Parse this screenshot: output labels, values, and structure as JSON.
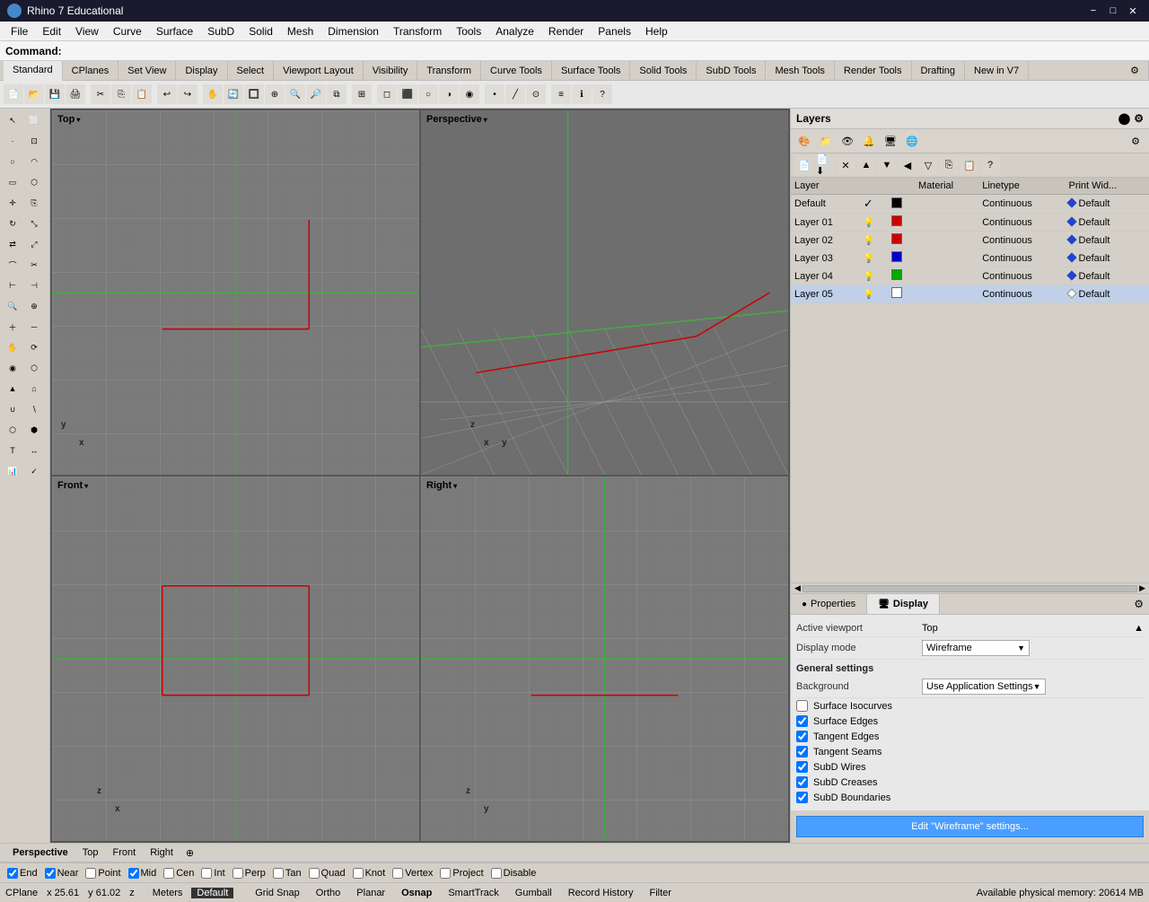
{
  "titlebar": {
    "icon": "rhino-icon",
    "title": "Rhino 7 Educational",
    "minimize": "−",
    "maximize": "□",
    "close": "✕"
  },
  "menubar": {
    "items": [
      "File",
      "Edit",
      "View",
      "Curve",
      "Surface",
      "SubD",
      "Solid",
      "Mesh",
      "Dimension",
      "Transform",
      "Tools",
      "Analyze",
      "Render",
      "Panels",
      "Help"
    ]
  },
  "commandbar": {
    "label": "Command:",
    "placeholder": ""
  },
  "toolbar_tabs": {
    "tabs": [
      "Standard",
      "CPlanes",
      "Set View",
      "Display",
      "Select",
      "Viewport Layout",
      "Visibility",
      "Transform",
      "Curve Tools",
      "Surface Tools",
      "Solid Tools",
      "SubD Tools",
      "Mesh Tools",
      "Render Tools",
      "Drafting",
      "New in V7"
    ]
  },
  "viewports": {
    "top": {
      "label": "Top",
      "arrow": "▾"
    },
    "perspective": {
      "label": "Perspective",
      "arrow": "▾"
    },
    "front": {
      "label": "Front",
      "arrow": "▾"
    },
    "right": {
      "label": "Right",
      "arrow": "▾"
    }
  },
  "layers_panel": {
    "title": "Layers",
    "columns": [
      "Layer",
      "",
      "",
      "Material",
      "Linetype",
      "Print Width"
    ],
    "rows": [
      {
        "name": "Default",
        "checked": true,
        "color": "black",
        "material": "",
        "linetype": "Continuous",
        "printwidth": "Default",
        "diamond": "filled"
      },
      {
        "name": "Layer 01",
        "checked": false,
        "color": "red",
        "material": "",
        "linetype": "Continuous",
        "printwidth": "Default",
        "diamond": "filled"
      },
      {
        "name": "Layer 02",
        "checked": false,
        "color": "red",
        "material": "",
        "linetype": "Continuous",
        "printwidth": "Default",
        "diamond": "filled"
      },
      {
        "name": "Layer 03",
        "checked": false,
        "color": "blue",
        "material": "",
        "linetype": "Continuous",
        "printwidth": "Default",
        "diamond": "filled"
      },
      {
        "name": "Layer 04",
        "checked": false,
        "color": "green",
        "material": "",
        "linetype": "Continuous",
        "printwidth": "Default",
        "diamond": "filled"
      },
      {
        "name": "Layer 05",
        "checked": false,
        "color": "white",
        "material": "",
        "linetype": "Continuous",
        "printwidth": "Default",
        "diamond": "empty"
      }
    ]
  },
  "properties_panel": {
    "tabs": [
      "Properties",
      "Display"
    ],
    "active_tab": "Display",
    "active_viewport_label": "Active viewport",
    "active_viewport_value": "Top",
    "display_mode_label": "Display mode",
    "display_mode_value": "Wireframe",
    "general_settings_title": "General settings",
    "background_label": "Background",
    "background_value": "Use Application Settings",
    "surface_isocurves_label": "Surface Isocurves",
    "surface_isocurves": false,
    "surface_edges_label": "Surface Edges",
    "surface_edges": true,
    "tangent_edges_label": "Tangent Edges",
    "tangent_edges": true,
    "tangent_seams_label": "Tangent Seams",
    "tangent_seams": true,
    "subd_wires_label": "SubD Wires",
    "subd_wires": true,
    "subd_creases_label": "SubD Creases",
    "subd_creases": true,
    "subd_boundaries_label": "SubD Boundaries",
    "subd_boundaries": true,
    "edit_button": "Edit \"Wireframe\" settings..."
  },
  "statusbar": {
    "vp_labels": [
      "Perspective",
      "Top",
      "Front",
      "Right"
    ],
    "active_vp": "Perspective",
    "icon": "⊕",
    "cplane": "CPlane",
    "x": "x 25.61",
    "y": "y 61.02",
    "z": "z",
    "meters": "Meters",
    "default": "Default",
    "grid_snap": "Grid Snap",
    "ortho": "Ortho",
    "planar": "Planar",
    "osnap": "Osnap",
    "smart_track": "SmartTrack",
    "gumball": "Gumball",
    "record_history": "Record History",
    "filter": "Filter",
    "memory": "Available physical memory: 20614 MB"
  },
  "snapbar": {
    "snaps": [
      {
        "label": "End",
        "checked": true
      },
      {
        "label": "Near",
        "checked": true
      },
      {
        "label": "Point",
        "checked": false
      },
      {
        "label": "Mid",
        "checked": true
      },
      {
        "label": "Cen",
        "checked": false
      },
      {
        "label": "Int",
        "checked": false
      },
      {
        "label": "Perp",
        "checked": false
      },
      {
        "label": "Tan",
        "checked": false
      },
      {
        "label": "Quad",
        "checked": false
      },
      {
        "label": "Knot",
        "checked": false
      },
      {
        "label": "Vertex",
        "checked": false
      },
      {
        "label": "Project",
        "checked": false
      },
      {
        "label": "Disable",
        "checked": false
      }
    ]
  },
  "left_toolbar": {
    "buttons": [
      "↖",
      "◻",
      "○",
      "⟳",
      "⬜",
      "⚙",
      "↔",
      "⟲",
      "✂",
      "📋",
      "🔲",
      "↕",
      "⟳",
      "🔍",
      "➕",
      "✱",
      "⊕",
      "⬡",
      "⛳",
      "🔧",
      "▶",
      "⬡",
      "🔩",
      "⚙"
    ]
  }
}
